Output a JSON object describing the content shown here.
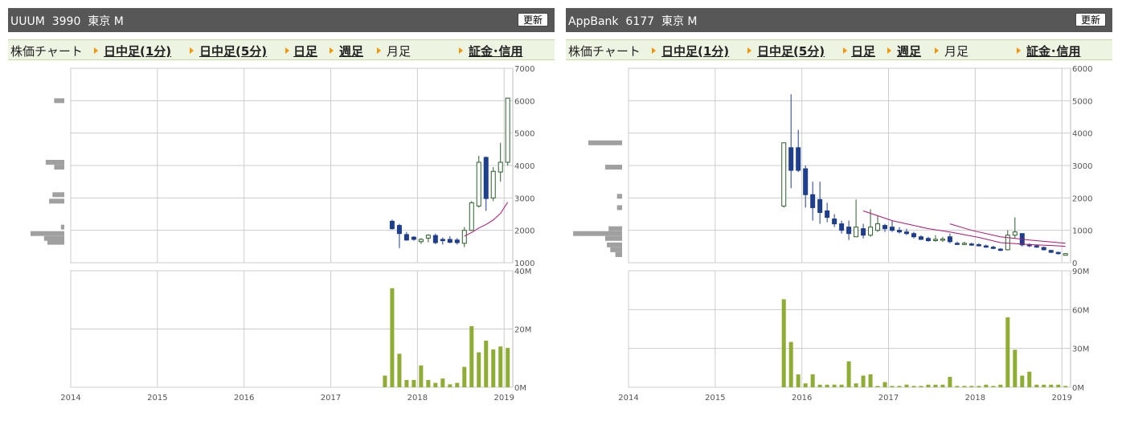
{
  "panels": [
    {
      "title": "UUUM  3990  東京 M",
      "refresh_label": "更新",
      "menu": {
        "chart_label": "株価チャート",
        "intraday1": "日中足(1分)",
        "intraday5": "日中足(5分)",
        "daily": "日足",
        "weekly": "週足",
        "monthly": "月足",
        "margin": "証金･信用"
      }
    },
    {
      "title": "AppBank  6177  東京 M",
      "refresh_label": "更新",
      "menu": {
        "chart_label": "株価チャート",
        "intraday1": "日中足(1分)",
        "intraday5": "日中足(5分)",
        "daily": "日足",
        "weekly": "週足",
        "monthly": "月足",
        "margin": "証金･信用"
      }
    }
  ],
  "chart_data": [
    {
      "type": "candlestick",
      "title": "",
      "x_ticks": [
        "2014",
        "2015",
        "2016",
        "2017",
        "2018",
        "2019"
      ],
      "x_range": [
        2014.0,
        2019.1
      ],
      "price_ticks": [
        "1000",
        "2000",
        "3000",
        "4000",
        "5000",
        "6000",
        "7000"
      ],
      "price_range": [
        1000,
        7000
      ],
      "volume_ticks": [
        "0M",
        "20M",
        "40M"
      ],
      "volume_range": [
        0,
        40
      ],
      "colors": {
        "up": "#ffffff",
        "down": "#1f3e8c",
        "ma": "#b0156e",
        "volume": "#8fac35",
        "profile": "#a0a0a0",
        "grid": "#cccccc"
      },
      "candles": [
        {
          "t": "2017-09",
          "o": 2280,
          "h": 2330,
          "l": 2020,
          "c": 2050
        },
        {
          "t": "2017-10",
          "o": 2150,
          "h": 2200,
          "l": 1450,
          "c": 1900
        },
        {
          "t": "2017-11",
          "o": 1870,
          "h": 1950,
          "l": 1680,
          "c": 1700
        },
        {
          "t": "2017-12",
          "o": 1790,
          "h": 1820,
          "l": 1680,
          "c": 1720
        },
        {
          "t": "2018-01",
          "o": 1650,
          "h": 1760,
          "l": 1580,
          "c": 1720
        },
        {
          "t": "2018-02",
          "o": 1760,
          "h": 1880,
          "l": 1630,
          "c": 1850
        },
        {
          "t": "2018-03",
          "o": 1840,
          "h": 1900,
          "l": 1570,
          "c": 1620
        },
        {
          "t": "2018-04",
          "o": 1720,
          "h": 1780,
          "l": 1560,
          "c": 1680
        },
        {
          "t": "2018-05",
          "o": 1720,
          "h": 1820,
          "l": 1600,
          "c": 1630
        },
        {
          "t": "2018-06",
          "o": 1700,
          "h": 1760,
          "l": 1560,
          "c": 1620
        },
        {
          "t": "2018-07",
          "o": 1600,
          "h": 2100,
          "l": 1480,
          "c": 2000
        },
        {
          "t": "2018-08",
          "o": 2000,
          "h": 2900,
          "l": 1980,
          "c": 2850
        },
        {
          "t": "2018-09",
          "o": 2750,
          "h": 4300,
          "l": 2700,
          "c": 4100
        },
        {
          "t": "2018-10",
          "o": 4250,
          "h": 4280,
          "l": 2600,
          "c": 2980
        },
        {
          "t": "2018-11",
          "o": 3000,
          "h": 3950,
          "l": 2900,
          "c": 3820
        },
        {
          "t": "2018-12",
          "o": 3800,
          "h": 4700,
          "l": 3500,
          "c": 4100
        },
        {
          "t": "2019-01",
          "o": 4100,
          "h": 6080,
          "l": 4000,
          "c": 6080
        }
      ],
      "ma": [
        {
          "t": "2018-07",
          "v": 1820
        },
        {
          "t": "2018-08",
          "v": 1930
        },
        {
          "t": "2018-09",
          "v": 2070
        },
        {
          "t": "2018-10",
          "v": 2180
        },
        {
          "t": "2018-11",
          "v": 2320
        },
        {
          "t": "2018-12",
          "v": 2520
        },
        {
          "t": "2019-01",
          "v": 2870
        }
      ],
      "volume": [
        {
          "t": "2017-08",
          "v": 4
        },
        {
          "t": "2017-09",
          "v": 34
        },
        {
          "t": "2017-10",
          "v": 11.5
        },
        {
          "t": "2017-11",
          "v": 2.5
        },
        {
          "t": "2017-12",
          "v": 2.5
        },
        {
          "t": "2018-01",
          "v": 7.5
        },
        {
          "t": "2018-02",
          "v": 2.5
        },
        {
          "t": "2018-03",
          "v": 1.5
        },
        {
          "t": "2018-04",
          "v": 3
        },
        {
          "t": "2018-05",
          "v": 1
        },
        {
          "t": "2018-06",
          "v": 1.5
        },
        {
          "t": "2018-07",
          "v": 7
        },
        {
          "t": "2018-08",
          "v": 21
        },
        {
          "t": "2018-09",
          "v": 12
        },
        {
          "t": "2018-10",
          "v": 16
        },
        {
          "t": "2018-11",
          "v": 13
        },
        {
          "t": "2018-12",
          "v": 14
        },
        {
          "t": "2019-01",
          "v": 13.5
        }
      ],
      "volume_profile": [
        {
          "price": 6000,
          "weight": 0.3
        },
        {
          "price": 4100,
          "weight": 0.55
        },
        {
          "price": 3950,
          "weight": 0.3
        },
        {
          "price": 3100,
          "weight": 0.35
        },
        {
          "price": 2900,
          "weight": 0.45
        },
        {
          "price": 2100,
          "weight": 0.1
        },
        {
          "price": 1900,
          "weight": 1.0
        },
        {
          "price": 1750,
          "weight": 0.6
        },
        {
          "price": 1630,
          "weight": 0.5
        }
      ]
    },
    {
      "type": "candlestick",
      "title": "",
      "x_ticks": [
        "2014",
        "2015",
        "2016",
        "2017",
        "2018",
        "2019"
      ],
      "x_range": [
        2014.0,
        2019.1
      ],
      "price_ticks": [
        "0",
        "1000",
        "2000",
        "3000",
        "4000",
        "5000",
        "6000"
      ],
      "price_range": [
        0,
        6000
      ],
      "volume_ticks": [
        "0M",
        "30M",
        "60M",
        "90M"
      ],
      "volume_range": [
        0,
        90
      ],
      "colors": {
        "up": "#ffffff",
        "down": "#1f3e8c",
        "ma": "#b0156e",
        "volume": "#8fac35",
        "profile": "#a0a0a0",
        "grid": "#cccccc"
      },
      "candles": [
        {
          "t": "2015-10",
          "o": 1750,
          "h": 1850,
          "l": 1700,
          "c": 3700
        },
        {
          "t": "2015-11",
          "o": 3550,
          "h": 5200,
          "l": 2300,
          "c": 2850
        },
        {
          "t": "2015-12",
          "o": 3550,
          "h": 4100,
          "l": 2800,
          "c": 2850
        },
        {
          "t": "2016-01",
          "o": 2900,
          "h": 3000,
          "l": 1700,
          "c": 2100
        },
        {
          "t": "2016-02",
          "o": 2100,
          "h": 2500,
          "l": 1300,
          "c": 1700
        },
        {
          "t": "2016-03",
          "o": 1950,
          "h": 2500,
          "l": 1200,
          "c": 1550
        },
        {
          "t": "2016-04",
          "o": 1600,
          "h": 1850,
          "l": 1250,
          "c": 1400
        },
        {
          "t": "2016-05",
          "o": 1350,
          "h": 1500,
          "l": 1100,
          "c": 1200
        },
        {
          "t": "2016-06",
          "o": 1200,
          "h": 1300,
          "l": 900,
          "c": 1000
        },
        {
          "t": "2016-07",
          "o": 1100,
          "h": 1300,
          "l": 700,
          "c": 900
        },
        {
          "t": "2016-08",
          "o": 800,
          "h": 1950,
          "l": 800,
          "c": 1100
        },
        {
          "t": "2016-09",
          "o": 1050,
          "h": 1200,
          "l": 750,
          "c": 850
        },
        {
          "t": "2016-10",
          "o": 850,
          "h": 1650,
          "l": 800,
          "c": 1100
        },
        {
          "t": "2016-11",
          "o": 1000,
          "h": 1450,
          "l": 950,
          "c": 1200
        },
        {
          "t": "2016-12",
          "o": 1150,
          "h": 1200,
          "l": 950,
          "c": 1050
        },
        {
          "t": "2017-01",
          "o": 1100,
          "h": 1300,
          "l": 950,
          "c": 1000
        },
        {
          "t": "2017-02",
          "o": 1000,
          "h": 1100,
          "l": 900,
          "c": 950
        },
        {
          "t": "2017-03",
          "o": 950,
          "h": 1050,
          "l": 850,
          "c": 900
        },
        {
          "t": "2017-04",
          "o": 900,
          "h": 950,
          "l": 750,
          "c": 800
        },
        {
          "t": "2017-05",
          "o": 800,
          "h": 850,
          "l": 700,
          "c": 720
        },
        {
          "t": "2017-06",
          "o": 750,
          "h": 800,
          "l": 650,
          "c": 680
        },
        {
          "t": "2017-07",
          "o": 700,
          "h": 850,
          "l": 650,
          "c": 720
        },
        {
          "t": "2017-08",
          "o": 700,
          "h": 800,
          "l": 650,
          "c": 730
        },
        {
          "t": "2017-09",
          "o": 800,
          "h": 900,
          "l": 600,
          "c": 650
        },
        {
          "t": "2017-10",
          "o": 600,
          "h": 650,
          "l": 550,
          "c": 580
        },
        {
          "t": "2017-11",
          "o": 580,
          "h": 650,
          "l": 540,
          "c": 600
        },
        {
          "t": "2017-12",
          "o": 580,
          "h": 620,
          "l": 520,
          "c": 550
        },
        {
          "t": "2018-01",
          "o": 560,
          "h": 600,
          "l": 500,
          "c": 520
        },
        {
          "t": "2018-02",
          "o": 520,
          "h": 560,
          "l": 460,
          "c": 480
        },
        {
          "t": "2018-03",
          "o": 480,
          "h": 520,
          "l": 420,
          "c": 440
        },
        {
          "t": "2018-04",
          "o": 420,
          "h": 450,
          "l": 360,
          "c": 380
        },
        {
          "t": "2018-05",
          "o": 400,
          "h": 1000,
          "l": 380,
          "c": 850
        },
        {
          "t": "2018-06",
          "o": 850,
          "h": 1400,
          "l": 750,
          "c": 950
        },
        {
          "t": "2018-07",
          "o": 900,
          "h": 900,
          "l": 500,
          "c": 550
        },
        {
          "t": "2018-08",
          "o": 560,
          "h": 600,
          "l": 480,
          "c": 520
        },
        {
          "t": "2018-09",
          "o": 520,
          "h": 560,
          "l": 460,
          "c": 480
        },
        {
          "t": "2018-10",
          "o": 470,
          "h": 500,
          "l": 380,
          "c": 400
        },
        {
          "t": "2018-11",
          "o": 380,
          "h": 400,
          "l": 300,
          "c": 320
        },
        {
          "t": "2018-12",
          "o": 320,
          "h": 340,
          "l": 250,
          "c": 280
        },
        {
          "t": "2019-01",
          "o": 230,
          "h": 300,
          "l": 220,
          "c": 280
        }
      ],
      "ma": [
        {
          "t": "2016-09",
          "v": 1600
        },
        {
          "t": "2016-11",
          "v": 1450
        },
        {
          "t": "2017-01",
          "v": 1300
        },
        {
          "t": "2017-03",
          "v": 1200
        },
        {
          "t": "2017-06",
          "v": 1050
        },
        {
          "t": "2017-09",
          "v": 950
        },
        {
          "t": "2018-01",
          "v": 780
        },
        {
          "t": "2018-04",
          "v": 620
        },
        {
          "t": "2018-08",
          "v": 560
        },
        {
          "t": "2018-12",
          "v": 520
        },
        {
          "t": "2019-01",
          "v": 500
        }
      ],
      "ma2": [
        {
          "t": "2017-09",
          "v": 1200
        },
        {
          "t": "2017-12",
          "v": 1000
        },
        {
          "t": "2018-04",
          "v": 800
        },
        {
          "t": "2018-08",
          "v": 700
        },
        {
          "t": "2019-01",
          "v": 600
        }
      ],
      "volume": [
        {
          "t": "2015-10",
          "v": 68
        },
        {
          "t": "2015-11",
          "v": 35
        },
        {
          "t": "2015-12",
          "v": 10
        },
        {
          "t": "2016-01",
          "v": 3
        },
        {
          "t": "2016-02",
          "v": 10
        },
        {
          "t": "2016-03",
          "v": 2
        },
        {
          "t": "2016-04",
          "v": 2
        },
        {
          "t": "2016-05",
          "v": 2
        },
        {
          "t": "2016-06",
          "v": 2
        },
        {
          "t": "2016-07",
          "v": 20
        },
        {
          "t": "2016-08",
          "v": 3
        },
        {
          "t": "2016-09",
          "v": 9
        },
        {
          "t": "2016-10",
          "v": 10
        },
        {
          "t": "2016-11",
          "v": 1
        },
        {
          "t": "2016-12",
          "v": 4
        },
        {
          "t": "2017-01",
          "v": 1
        },
        {
          "t": "2017-02",
          "v": 1
        },
        {
          "t": "2017-03",
          "v": 2
        },
        {
          "t": "2017-04",
          "v": 1
        },
        {
          "t": "2017-05",
          "v": 1
        },
        {
          "t": "2017-06",
          "v": 2
        },
        {
          "t": "2017-07",
          "v": 2
        },
        {
          "t": "2017-08",
          "v": 2
        },
        {
          "t": "2017-09",
          "v": 8
        },
        {
          "t": "2017-10",
          "v": 1
        },
        {
          "t": "2017-11",
          "v": 1
        },
        {
          "t": "2017-12",
          "v": 1
        },
        {
          "t": "2018-01",
          "v": 1
        },
        {
          "t": "2018-02",
          "v": 2
        },
        {
          "t": "2018-03",
          "v": 1
        },
        {
          "t": "2018-04",
          "v": 2
        },
        {
          "t": "2018-05",
          "v": 54
        },
        {
          "t": "2018-06",
          "v": 29
        },
        {
          "t": "2018-07",
          "v": 9
        },
        {
          "t": "2018-08",
          "v": 12
        },
        {
          "t": "2018-09",
          "v": 2
        },
        {
          "t": "2018-10",
          "v": 2
        },
        {
          "t": "2018-11",
          "v": 2
        },
        {
          "t": "2018-12",
          "v": 2
        },
        {
          "t": "2019-01",
          "v": 1
        }
      ],
      "volume_profile": [
        {
          "price": 3700,
          "weight": 1.0
        },
        {
          "price": 2950,
          "weight": 0.5
        },
        {
          "price": 2050,
          "weight": 0.15
        },
        {
          "price": 1700,
          "weight": 0.15
        },
        {
          "price": 1050,
          "weight": 0.4
        },
        {
          "price": 900,
          "weight": 1.45
        },
        {
          "price": 750,
          "weight": 0.5
        },
        {
          "price": 550,
          "weight": 0.45
        },
        {
          "price": 400,
          "weight": 0.35
        },
        {
          "price": 250,
          "weight": 0.2
        }
      ]
    }
  ]
}
